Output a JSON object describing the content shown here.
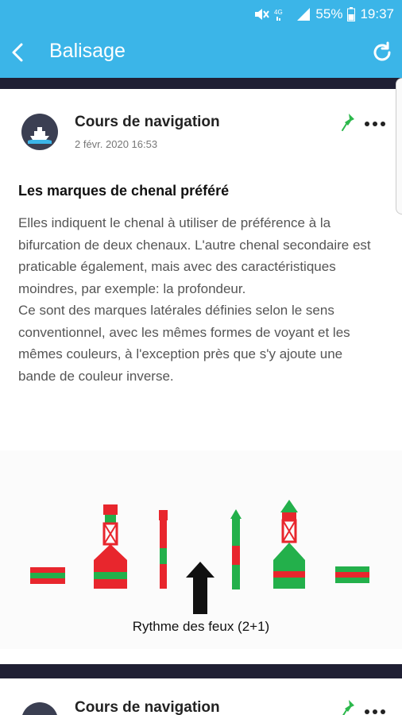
{
  "status_bar": {
    "battery": "55%",
    "time": "19:37"
  },
  "app_bar": {
    "title": "Balisage",
    "back_icon": "back-arrow-icon",
    "refresh_icon": "refresh-icon"
  },
  "post": {
    "author": "Cours de navigation",
    "date": "2 févr. 2020 16:53",
    "title": "Les marques de chenal préféré",
    "paragraph1": "Elles indiquent le chenal à utiliser de préférence à  la bifurcation de deux chenaux. L'autre chenal secondaire est praticable également, mais avec des caractéristiques moindres, par exemple: la profondeur.",
    "paragraph2": "Ce sont des marques latérales définies selon le sens conventionnel, avec les mêmes formes de voyant et les mêmes couleurs, à l'exception près que s'y ajoute une bande de couleur inverse.",
    "figure_caption": "Rythme des feux (2+1)",
    "colors": {
      "red": "#e8262d",
      "green": "#23b04b"
    }
  },
  "next_post": {
    "author": "Cours de navigation"
  }
}
